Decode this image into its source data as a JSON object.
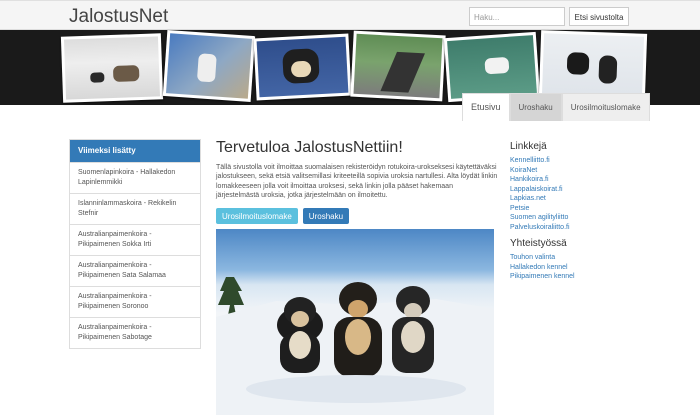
{
  "header": {
    "brand": "JalostusNet",
    "search_placeholder": "Haku...",
    "search_button": "Etsi sivustolta"
  },
  "tabs": [
    "Etusivu",
    "Uroshaku",
    "Urosilmoituslomake"
  ],
  "sidebar": {
    "heading": "Viimeksi lisätty",
    "items": [
      "Suomenlapinkoira - Hallakedon Lapinlemmikki",
      "Islanninlammaskoira - Rekikelin Stefnir",
      "Australianpaimenkoira - Pikipaimenen Sokka Irti",
      "Australianpaimenkoira - Pikipaimenen Sata Salamaa",
      "Australianpaimenkoira - Pikipaimenen Soronoo",
      "Australianpaimenkoira - Pikipaimenen Sabotage"
    ]
  },
  "main": {
    "title": "Tervetuloa JalostusNettiin!",
    "intro": "Tällä sivustolla voit ilmoittaa suomalaisen rekisteröidyn rotukoira-urokseksesi käytettäväksi jalostukseen, sekä etsiä valitsemillasi kriteeteillä sopivia uroksia nartullesi. Alta löydät linkin lomakkeeseen jolla voit ilmoittaa uroksesi, sekä linkin jolla pääset hakemaan järjestelmästä uroksia, jotka järjestelmään on ilmoitettu.",
    "btn_form": "Urosilmoituslomake",
    "btn_search": "Uroshaku"
  },
  "links": {
    "heading": "Linkkejä",
    "items": [
      "Kennelliitto.fi",
      "KoiraNet",
      "Hankikoira.fi",
      "Lappalaiskoirat.fi",
      "Lapkias.net",
      "Petsie",
      "Suomen agilityliitto",
      "Palveluskoiraliitto.fi"
    ]
  },
  "partners": {
    "heading": "Yhteistyössä",
    "items": [
      "Touhon valinta",
      "Hallakedon kennel",
      "Pikipaimenen kennel"
    ]
  },
  "colors": {
    "primary": "#337ab7",
    "info": "#5bc0de"
  }
}
